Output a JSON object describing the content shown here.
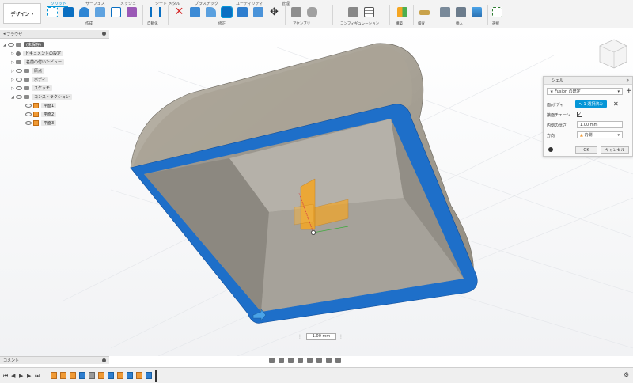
{
  "toolbar": {
    "design_menu": "デザイン",
    "workspace_tabs": [
      "ソリッド",
      "サーフェス",
      "メッシュ",
      "シート メタル",
      "プラスチック",
      "ユーティリティ",
      "管理"
    ],
    "groups": [
      "作成",
      "自動化",
      "修正",
      "アセンブリ",
      "コンフィギュレーション",
      "構築",
      "検査",
      "挿入",
      "選択"
    ]
  },
  "browser": {
    "title": "ブラウザ",
    "items": [
      {
        "label": "(未保存)"
      },
      {
        "label": "ドキュメントの設定"
      },
      {
        "label": "名前の付いたビュー"
      },
      {
        "label": "原点"
      },
      {
        "label": "ボディ"
      },
      {
        "label": "スケッチ"
      },
      {
        "label": "コンストラクション"
      },
      {
        "label": "平面1"
      },
      {
        "label": "平面2"
      },
      {
        "label": "平面3"
      }
    ]
  },
  "dialog": {
    "title": "シェル",
    "preset": "Fusion の既定",
    "face_body_label": "面/ボディ",
    "face_body_value": "1 選択済み",
    "tangent_chain_label": "接面チェーン",
    "inside_thickness_label": "内側の厚さ",
    "inside_thickness_value": "1.00 mm",
    "direction_label": "方向",
    "direction_value": "内側",
    "ok": "OK",
    "cancel": "キャンセル"
  },
  "viewport": {
    "value_input": "1.00 mm"
  },
  "comments": {
    "title": "コメント"
  },
  "colors": {
    "accent": "#0696d7",
    "shell_edge": "#1e6fc9",
    "body_top": "#a59f93",
    "body_inner": "#86837c",
    "plane": "#f5a623"
  }
}
